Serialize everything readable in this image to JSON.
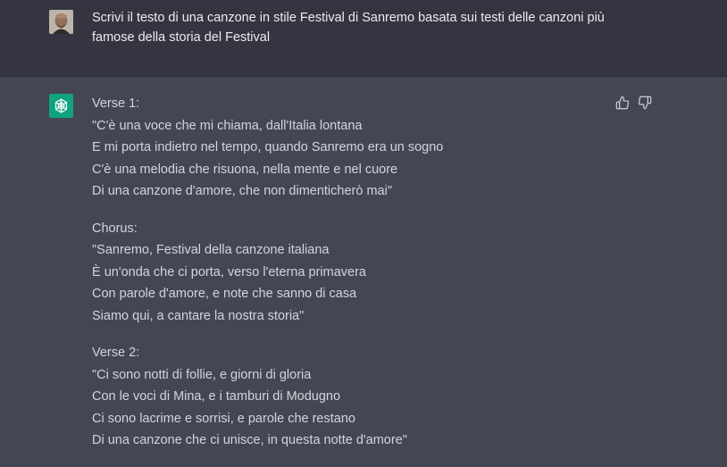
{
  "user_message": {
    "text": "Scrivi il testo di una canzone in stile Festival di Sanremo basata sui testi delle canzoni più famose della storia del Festival"
  },
  "assistant_message": {
    "stanzas": [
      {
        "title": "Verse 1:",
        "lines": [
          "\"C'è una voce che mi chiama, dall'Italia lontana",
          "E mi porta indietro nel tempo, quando Sanremo era un sogno",
          "C'è una melodia che risuona, nella mente e nel cuore",
          "Di una canzone d'amore, che non dimenticherò mai\""
        ]
      },
      {
        "title": "Chorus:",
        "lines": [
          "\"Sanremo, Festival della canzone italiana",
          "È un'onda che ci porta, verso l'eterna primavera",
          "Con parole d'amore, e note che sanno di casa",
          "Siamo qui, a cantare la nostra storia\""
        ]
      },
      {
        "title": "Verse 2:",
        "lines": [
          "\"Ci sono notti di follie, e giorni di gloria",
          "Con le voci di Mina, e i tamburi di Modugno",
          "Ci sono lacrime e sorrisi, e parole che restano",
          "Di una canzone che ci unisce, in questa notte d'amore\""
        ]
      }
    ]
  },
  "icons": {
    "user_avatar": "user-avatar-photo",
    "assistant_avatar": "openai-logo-icon",
    "thumbs_up": "thumbs-up-icon",
    "thumbs_down": "thumbs-down-icon"
  },
  "colors": {
    "user_bg": "#343541",
    "assistant_bg": "#444654",
    "accent": "#10a37f",
    "text": "#d1d5db"
  }
}
